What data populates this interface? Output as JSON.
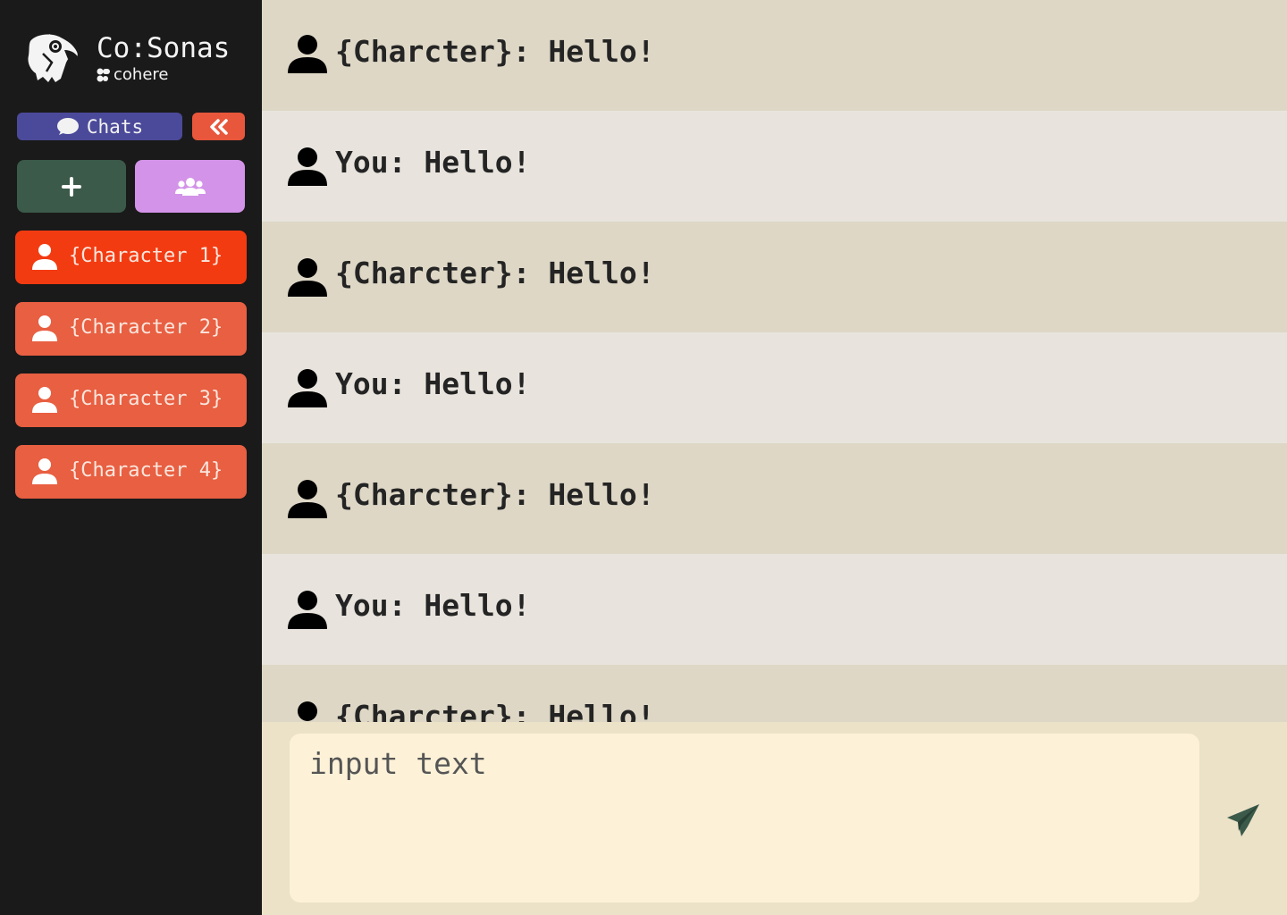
{
  "app": {
    "title": "Co:Sonas",
    "brand": "cohere"
  },
  "sidebar": {
    "chats_label": "Chats",
    "characters": [
      {
        "label": "{Character 1}",
        "active": true
      },
      {
        "label": "{Character 2}",
        "active": false
      },
      {
        "label": "{Character 3}",
        "active": false
      },
      {
        "label": "{Character 4}",
        "active": false
      }
    ]
  },
  "messages": [
    {
      "role": "character",
      "text": "{Charcter}: Hello!"
    },
    {
      "role": "user",
      "text": "You: Hello!"
    },
    {
      "role": "character",
      "text": "{Charcter}: Hello!"
    },
    {
      "role": "user",
      "text": "You: Hello!"
    },
    {
      "role": "character",
      "text": "{Charcter}: Hello!"
    },
    {
      "role": "user",
      "text": "You: Hello!"
    },
    {
      "role": "character",
      "text": "{Charcter}: Hello!"
    }
  ],
  "composer": {
    "placeholder": "input text",
    "value": ""
  },
  "icons": {
    "logo": "parrot-logo-icon",
    "chats": "chat-bubble-icon",
    "collapse": "double-chevron-left-icon",
    "new_chat": "plus-icon",
    "group": "users-group-icon",
    "character": "user-icon",
    "message_avatar": "user-icon",
    "send": "paper-plane-icon"
  },
  "colors": {
    "sidebar_bg": "#1a1a1a",
    "chats_tab": "#4b4a9a",
    "collapse_btn": "#e8573c",
    "new_chat_btn": "#3b5a4a",
    "group_btn": "#d393e8",
    "character_item": "#e85f42",
    "character_item_active": "#f33b12",
    "char_message_bg": "#ded7c6",
    "user_message_bg": "#e8e4dd",
    "composer_area_bg": "#ebe2c8",
    "input_bg": "#fdf2d8",
    "send_icon": "#3b5a4a"
  }
}
